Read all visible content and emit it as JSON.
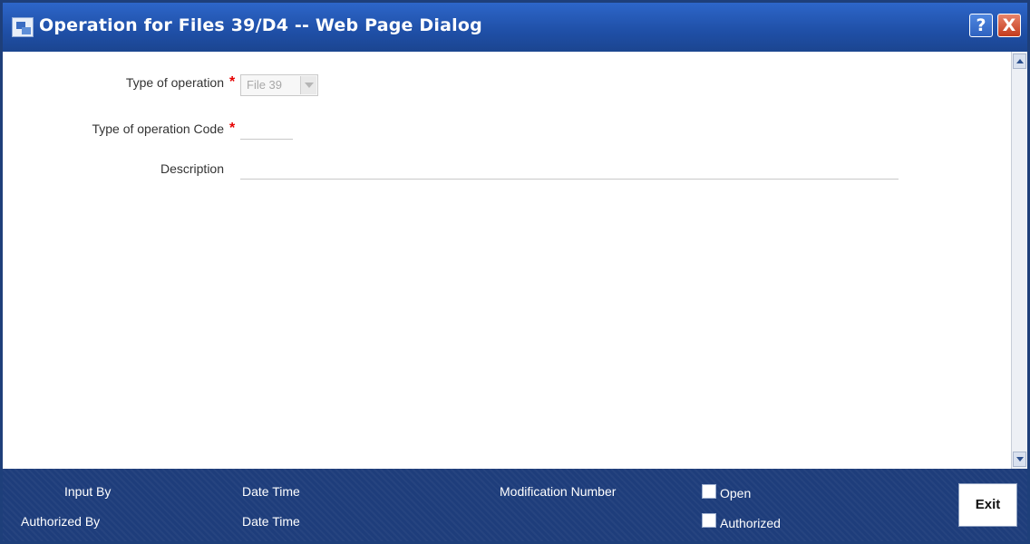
{
  "window": {
    "title": "Operation for Files 39/D4 -- Web Page Dialog",
    "help_label": "?",
    "close_label": "X"
  },
  "form": {
    "type_of_operation_label": "Type of operation",
    "type_of_operation_value": "File 39",
    "operation_code_label": "Type of operation Code",
    "operation_code_value": "",
    "description_label": "Description",
    "description_value": "",
    "required_marker": "*"
  },
  "footer": {
    "input_by_label": "Input By",
    "date_time_label_1": "Date Time",
    "modification_number_label": "Modification Number",
    "open_label": "Open",
    "open_checked": false,
    "authorized_by_label": "Authorized By",
    "date_time_label_2": "Date Time",
    "authorized_label": "Authorized",
    "authorized_checked": false,
    "exit_label": "Exit"
  },
  "colors": {
    "title_bar": "#2d66c9",
    "footer_bg": "#1e3d7b",
    "required": "#e60000"
  },
  "icons": [
    "window-app-icon",
    "help-icon",
    "close-icon",
    "dropdown-arrow-icon",
    "scroll-up-icon",
    "scroll-down-icon"
  ]
}
